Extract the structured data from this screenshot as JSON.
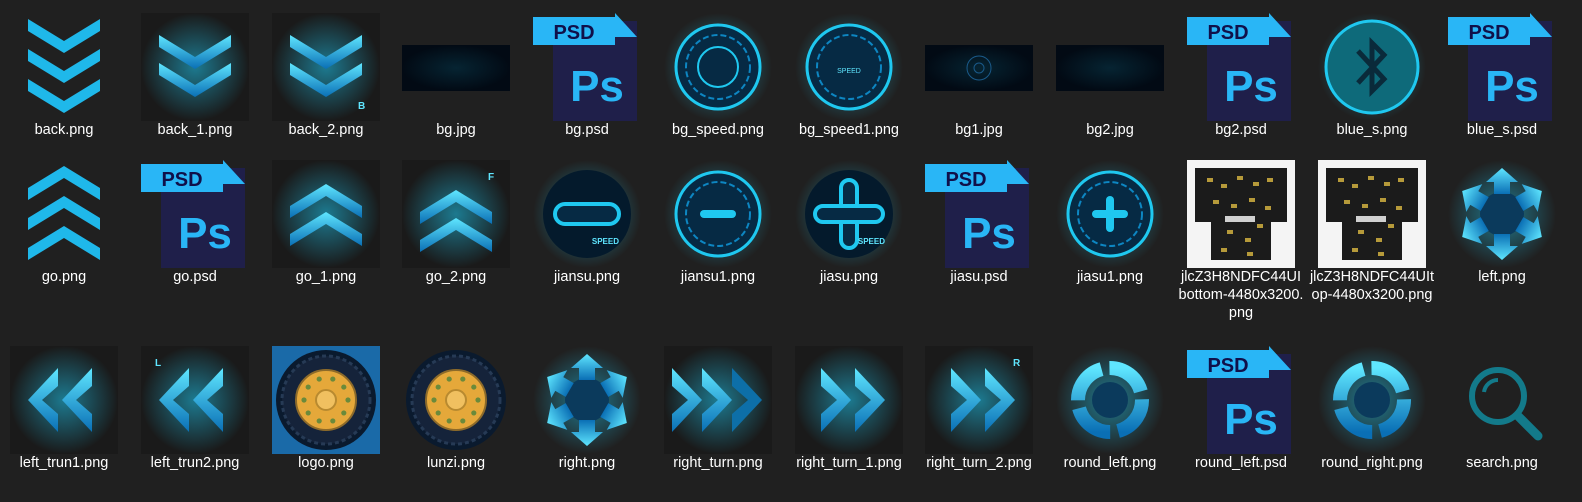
{
  "colors": {
    "background": "#202020",
    "accent_cyan": "#1fc8f0",
    "accent_dark": "#0a3a5a",
    "psd_bg": "#1f1f4a",
    "psd_tab": "#29b6f6",
    "label_text": "#ffffff"
  },
  "files": [
    {
      "name": "back.png",
      "icon": "chevrons-down-icon"
    },
    {
      "name": "back_1.png",
      "icon": "chevrons-down-glow-icon"
    },
    {
      "name": "back_2.png",
      "icon": "chevrons-down-b-icon"
    },
    {
      "name": "bg.jpg",
      "icon": "dark-image-thumbnail"
    },
    {
      "name": "bg.psd",
      "icon": "photoshop-file-icon"
    },
    {
      "name": "bg_speed.png",
      "icon": "speed-dial-icon"
    },
    {
      "name": "bg_speed1.png",
      "icon": "speed-dial-speed-icon"
    },
    {
      "name": "bg1.jpg",
      "icon": "dark-hud-image-thumbnail"
    },
    {
      "name": "bg2.jpg",
      "icon": "dark-image-thumbnail"
    },
    {
      "name": "bg2.psd",
      "icon": "photoshop-file-icon"
    },
    {
      "name": "blue_s.png",
      "icon": "bluetooth-icon"
    },
    {
      "name": "blue_s.psd",
      "icon": "photoshop-file-icon"
    },
    {
      "name": "go.png",
      "icon": "chevrons-up-icon"
    },
    {
      "name": "go.psd",
      "icon": "photoshop-file-icon"
    },
    {
      "name": "go_1.png",
      "icon": "chevrons-up-glow-icon"
    },
    {
      "name": "go_2.png",
      "icon": "chevrons-up-f-icon"
    },
    {
      "name": "jiansu.png",
      "icon": "minus-speed-icon"
    },
    {
      "name": "jiansu1.png",
      "icon": "minus-circle-icon"
    },
    {
      "name": "jiasu.png",
      "icon": "plus-speed-icon"
    },
    {
      "name": "jiasu.psd",
      "icon": "photoshop-file-icon"
    },
    {
      "name": "jiasu1.png",
      "icon": "plus-circle-icon"
    },
    {
      "name": "jlcZ3H8NDFC44UIbottom-4480x3200.png",
      "icon": "pcb-board-thumbnail"
    },
    {
      "name": "jlcZ3H8NDFC44UItop-4480x3200.png",
      "icon": "pcb-board-thumbnail"
    },
    {
      "name": "left.png",
      "icon": "rotate-arrows-icon"
    },
    {
      "name": "left_trun1.png",
      "icon": "double-chevron-left-icon"
    },
    {
      "name": "left_trun2.png",
      "icon": "double-chevron-left-l-icon"
    },
    {
      "name": "logo.png",
      "icon": "wheel-square-icon"
    },
    {
      "name": "lunzi.png",
      "icon": "wheel-icon"
    },
    {
      "name": "right.png",
      "icon": "rotate-arrows-icon"
    },
    {
      "name": "right_turn.png",
      "icon": "triple-chevron-right-icon"
    },
    {
      "name": "right_turn_1.png",
      "icon": "double-chevron-right-icon"
    },
    {
      "name": "right_turn_2.png",
      "icon": "double-chevron-right-r-icon"
    },
    {
      "name": "round_left.png",
      "icon": "round-arrows-icon"
    },
    {
      "name": "round_left.psd",
      "icon": "photoshop-file-icon"
    },
    {
      "name": "round_right.png",
      "icon": "round-arrows-icon"
    },
    {
      "name": "search.png",
      "icon": "search-icon"
    }
  ],
  "icon_text": {
    "psd_tab": "PSD",
    "ps_logo": "Ps",
    "speed": "SPEED",
    "letter_b": "B",
    "letter_f": "F",
    "letter_l": "L",
    "letter_r": "R"
  }
}
